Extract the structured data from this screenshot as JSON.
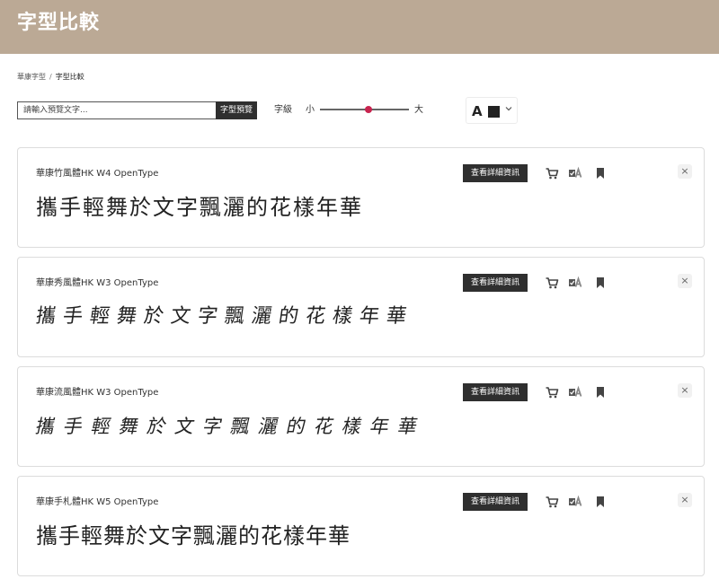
{
  "header": {
    "title": "字型比較"
  },
  "breadcrumb": {
    "home": "華康字型",
    "separator": "/",
    "current": "字型比較"
  },
  "search": {
    "placeholder": "請輸入預覽文字...",
    "value": "",
    "button_label": "字型預覽"
  },
  "size_control": {
    "label": "字級",
    "small": "小",
    "large": "大",
    "level": 0.55
  },
  "color_control": {
    "letter": "A",
    "selected_color": "#222222"
  },
  "cards": [
    {
      "font_name": "華康竹風體HK W4 OpenType",
      "sample_text": "攜手輕舞於文字飄灑的花樣年華",
      "details_label": "查看詳細資訊",
      "close_label": "×"
    },
    {
      "font_name": "華康秀風體HK W3 OpenType",
      "sample_text": "攜手輕舞於文字飄灑的花樣年華",
      "details_label": "查看詳細資訊",
      "close_label": "×"
    },
    {
      "font_name": "華康流風體HK W3 OpenType",
      "sample_text": "攜手輕舞於文字飄灑的花樣年華",
      "details_label": "查看詳細資訊",
      "close_label": "×"
    },
    {
      "font_name": "華康手札體HK W5 OpenType",
      "sample_text": "攜手輕舞於文字飄灑的花樣年華",
      "details_label": "查看詳細資訊",
      "close_label": "×"
    }
  ],
  "icons": {
    "cart": "cart-icon",
    "font_compare": "font-compare-icon",
    "bookmark": "bookmark-icon",
    "close": "close-icon",
    "chevron": "chevron-down-icon"
  },
  "colors": {
    "header": "#bba995",
    "button": "#2f2f2f",
    "slider_thumb": "#c8244f"
  }
}
